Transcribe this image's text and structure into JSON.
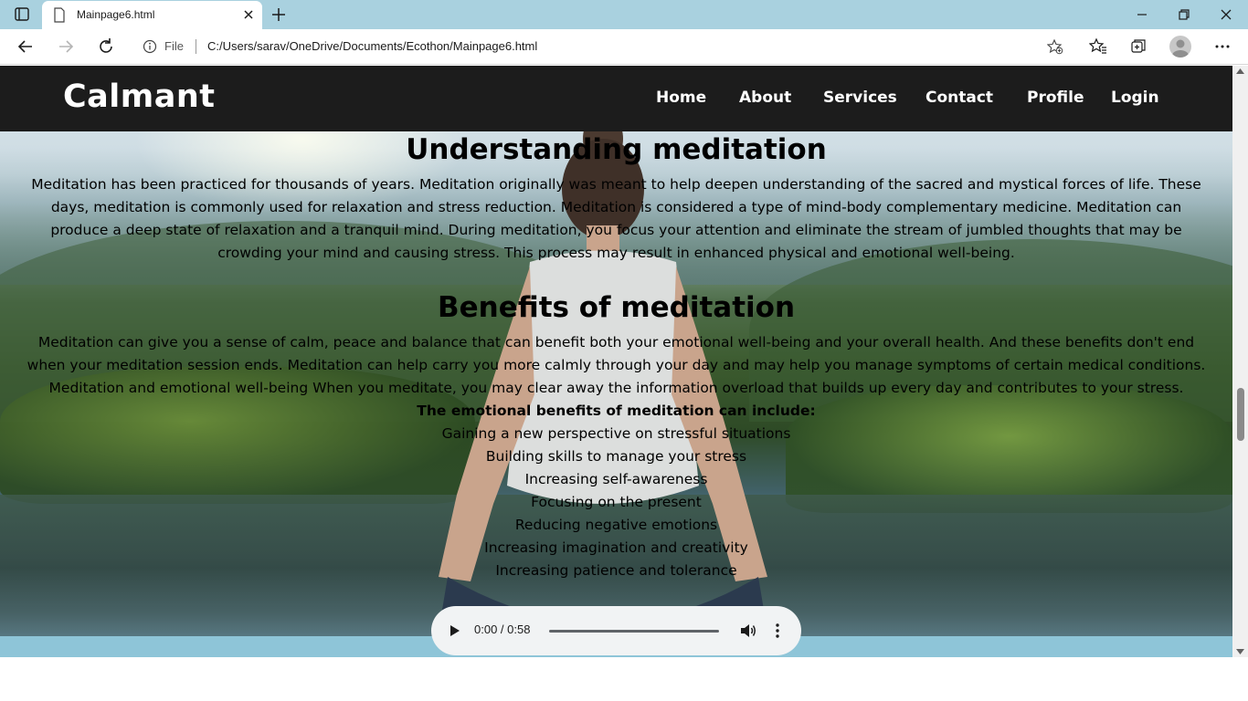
{
  "browser": {
    "tab_title": "Mainpage6.html",
    "address_prefix": "File",
    "url": "C:/Users/sarav/OneDrive/Documents/Ecothon/Mainpage6.html"
  },
  "site": {
    "brand": "Calmant",
    "nav": [
      "Home",
      "About",
      "Services",
      "Contact",
      "Profile",
      "Login"
    ]
  },
  "content": {
    "section1": {
      "heading": "Understanding meditation",
      "lines": [
        "Meditation has been practiced for thousands of years. Meditation originally was meant to help deepen understanding of the sacred and mystical forces of life. These",
        "days, meditation is commonly used for relaxation and stress reduction. Meditation is considered a type of mind-body complementary medicine. Meditation can",
        "produce a deep state of relaxation and a tranquil mind. During meditation, you focus your attention and eliminate the stream of jumbled thoughts that may be",
        "crowding your mind and causing stress. This process may result in enhanced physical and emotional well-being."
      ]
    },
    "section2": {
      "heading": "Benefits of meditation",
      "lines": [
        "Meditation can give you a sense of calm, peace and balance that can benefit both your emotional well-being and your overall health. And these benefits don't end",
        "when your meditation session ends. Meditation can help carry you more calmly through your day and may help you manage symptoms of certain medical conditions.",
        "Meditation and emotional well-being When you meditate, you may clear away the information overload that builds up every day and contributes to your stress."
      ],
      "list_title": "The emotional benefits of meditation can include:",
      "list": [
        "Gaining a new perspective on stressful situations",
        "Building skills to manage your stress",
        "Increasing self-awareness",
        "Focusing on the present",
        "Reducing negative emotions",
        "Increasing imagination and creativity",
        "Increasing patience and tolerance"
      ]
    }
  },
  "audio": {
    "time": "0:00 / 0:58"
  },
  "icons": {
    "play": "play-icon",
    "volume": "volume-icon",
    "more": "more-vertical-icon"
  }
}
